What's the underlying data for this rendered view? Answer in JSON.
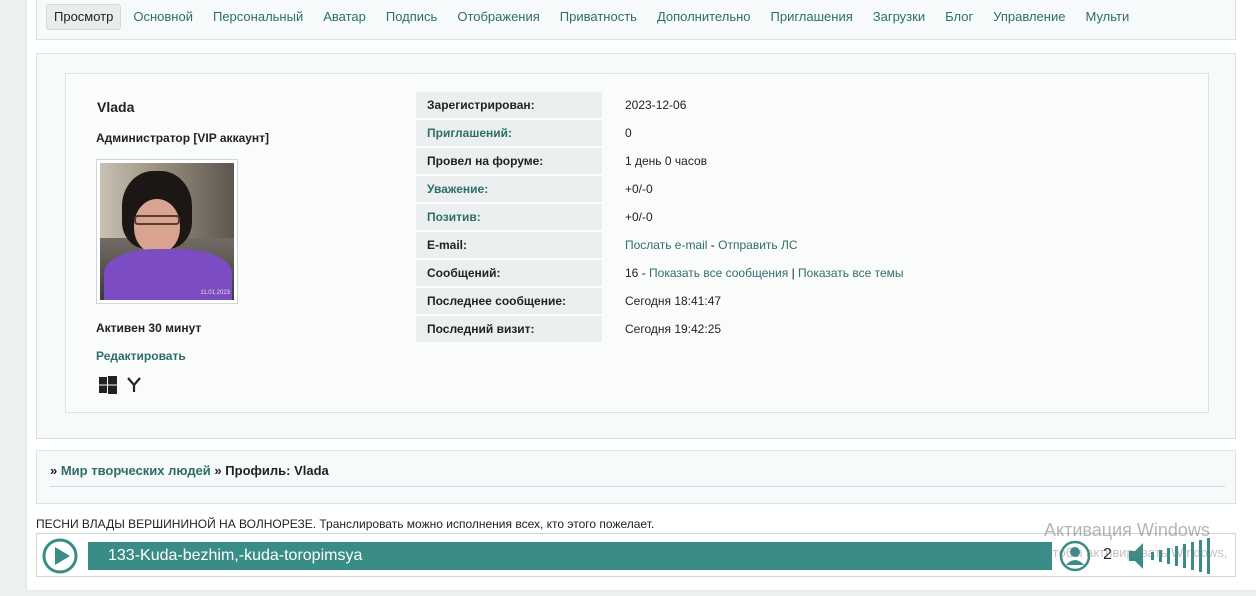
{
  "tabs": [
    {
      "label": "Просмотр",
      "active": true
    },
    {
      "label": "Основной"
    },
    {
      "label": "Персональный"
    },
    {
      "label": "Аватар"
    },
    {
      "label": "Подпись"
    },
    {
      "label": "Отображения"
    },
    {
      "label": "Приватность"
    },
    {
      "label": "Дополнительно"
    },
    {
      "label": "Приглашения"
    },
    {
      "label": "Загрузки"
    },
    {
      "label": "Блог"
    },
    {
      "label": "Управление"
    },
    {
      "label": "Мульти"
    }
  ],
  "profile": {
    "username": "Vlada",
    "role": "Администратор [VIP аккаунт]",
    "active_since": "Активен 30 минут",
    "edit_label": "Редактировать",
    "avatar_stamp": "11.01.2023",
    "os_icons": [
      "windows-icon",
      "yandex-browser-icon"
    ]
  },
  "info": {
    "registered_label": "Зарегистрирован:",
    "registered_value": "2023-12-06",
    "invites_label": "Приглашений:",
    "invites_value": "0",
    "time_label": "Провел на форуме:",
    "time_value": "1 день 0 часов",
    "respect_label": "Уважение:",
    "respect_value": "+0/-0",
    "positive_label": "Позитив:",
    "positive_value": "+0/-0",
    "email_label": "E-mail:",
    "email_link": "Послать e-mail",
    "email_sep": " - ",
    "pm_link": "Отправить ЛС",
    "posts_label": "Сообщений:",
    "posts_count": "16",
    "posts_sep1": " - ",
    "posts_link": "Показать все сообщения",
    "posts_sep2": " | ",
    "topics_link": "Показать все темы",
    "last_post_label": "Последнее сообщение:",
    "last_post_value": "Сегодня 18:41:47",
    "last_visit_label": "Последний визит:",
    "last_visit_value": "Сегодня 19:42:25"
  },
  "breadcrumb": {
    "sep1": "» ",
    "forum": "Мир творческих людей",
    "sep2": " » ",
    "current": "Профиль: Vlada"
  },
  "radio": {
    "title": "ПЕСНИ ВЛАДЫ ВЕРШИНИНОЙ НА ВОЛНОРЕЗЕ. Транслировать можно исполнения всех, кто этого пожелает.",
    "track": "133-Kuda-bezhim,-kuda-toropimsya",
    "listeners": "2"
  },
  "watermark": {
    "line1": "Активация Windows",
    "line2": "Чтобы активировать Windows,"
  },
  "colors": {
    "accent": "#2f6d68",
    "player_bar": "#3a8c86"
  }
}
